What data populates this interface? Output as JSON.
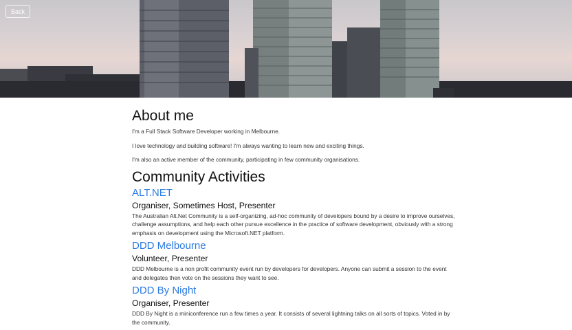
{
  "back_label": "Back",
  "about": {
    "title": "About me",
    "paragraphs": [
      "I'm a Full Stack Software Developer working in Melbourne.",
      "I love technology and building software! I'm always wanting to learn new and exciting things.",
      "I'm also an active member of the community, participating in few community organisations."
    ]
  },
  "community": {
    "title": "Community Activities",
    "items": [
      {
        "name": "ALT.NET",
        "role": "Organiser, Sometimes Host, Presenter",
        "description": "The Australian Alt.Net Community is a self-organizing, ad-hoc community of developers bound by a desire to improve ourselves, challenge assumptions, and help each other pursue excellence in the practice of software development, obviously with a strong emphasis on development using the Microsoft.NET platform."
      },
      {
        "name": "DDD Melbourne",
        "role": "Volunteer, Presenter",
        "description": "DDD Melbourne is a non profit community event run by developers for developers. Anyone can submit a session to the event and delegates then vote on the sessions they want to see."
      },
      {
        "name": "DDD By Night",
        "role": "Organiser, Presenter",
        "description": "DDD By Night is a miniconference run a few times a year. It consists of several lightning talks on all sorts of topics. Voted in by the community."
      }
    ]
  },
  "colors": {
    "link": "#2a7ae2",
    "heading": "#111111",
    "text": "#333333"
  }
}
